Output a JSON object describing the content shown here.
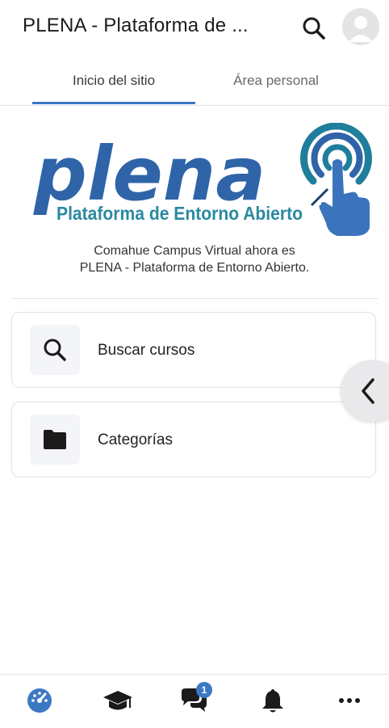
{
  "header": {
    "title": "PLENA - Plataforma de ...",
    "search_icon": "search-icon",
    "avatar_icon": "user-avatar-icon"
  },
  "tabs": [
    {
      "label": "Inicio del sitio",
      "active": true
    },
    {
      "label": "Área personal",
      "active": false
    }
  ],
  "logo": {
    "wordmark": "plena",
    "tagline": "Plataforma de Entorno Abierto",
    "brand_color": "#2f64a8",
    "accent_color": "#1f7e9b"
  },
  "intro": {
    "line1": "Comahue Campus Virtual ahora es",
    "line2": "PLENA - Plataforma de Entorno Abierto."
  },
  "cards": [
    {
      "label": "Buscar cursos",
      "icon": "search-icon"
    },
    {
      "label": "Categorías",
      "icon": "folder-icon"
    }
  ],
  "drawer": {
    "icon": "chevron-left-icon"
  },
  "bottom_nav": [
    {
      "icon": "dashboard-icon",
      "active": true
    },
    {
      "icon": "graduation-cap-icon"
    },
    {
      "icon": "chat-icon",
      "badge": "1"
    },
    {
      "icon": "bell-icon"
    },
    {
      "icon": "more-icon"
    }
  ],
  "colors": {
    "accent": "#3b78c4"
  }
}
